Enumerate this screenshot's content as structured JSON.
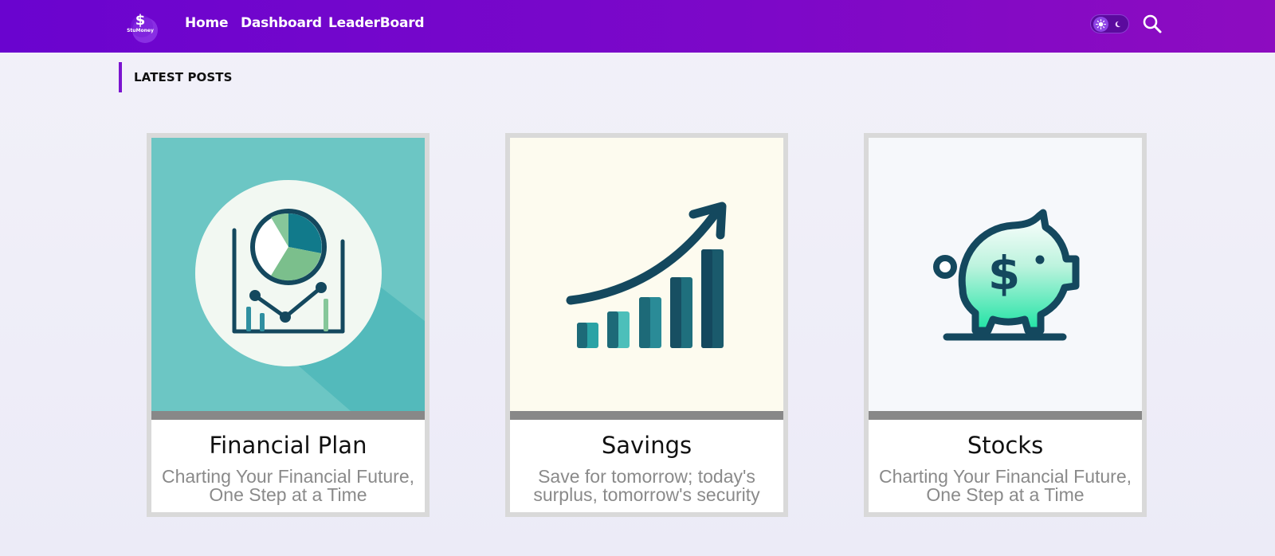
{
  "header": {
    "logo_symbol": "$",
    "logo_text": "StuMoney",
    "nav": [
      {
        "label": "Home"
      },
      {
        "label": "Dashboard"
      },
      {
        "label": "LeaderBoard"
      }
    ],
    "theme_toggle": {
      "state": "light",
      "icons": [
        "sun-icon",
        "moon-icon"
      ]
    },
    "search_icon": "search-icon"
  },
  "section": {
    "title": "LATEST POSTS"
  },
  "posts": [
    {
      "title": "Financial Plan",
      "subtitle": "Charting Your Financial Future, One Step at a Time",
      "image": "pie-and-line-chart-illustration",
      "image_bg": "#6cc6c4"
    },
    {
      "title": "Savings",
      "subtitle": "Save for tomorrow; today's surplus, tomorrow's security",
      "image": "growth-bar-chart-arrow-illustration",
      "image_bg": "#fdfbef"
    },
    {
      "title": "Stocks",
      "subtitle": "Charting Your Financial Future, One Step at a Time",
      "image": "piggy-bank-dollar-illustration",
      "image_bg": "#f6f8fb"
    }
  ],
  "colors": {
    "header_start": "#6a04cf",
    "header_end": "#8d0cc0",
    "accent": "#7b14cf",
    "icon_dark": "#14485e",
    "teal": "#2aa3a5"
  }
}
